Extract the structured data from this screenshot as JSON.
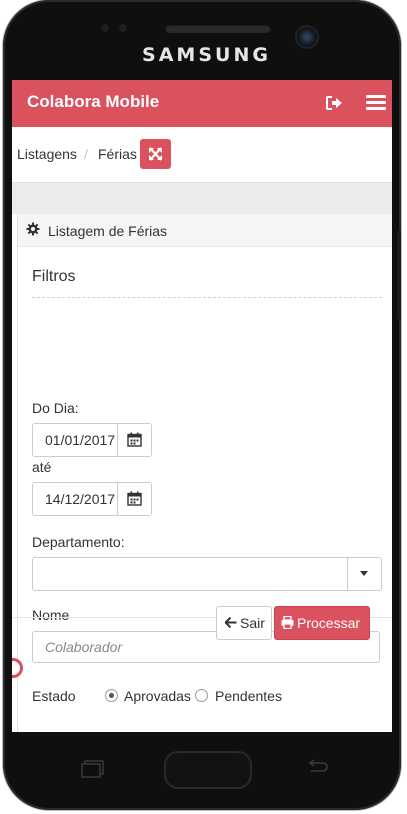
{
  "device": {
    "brand": "SAMSUNG"
  },
  "appbar": {
    "title": "Colabora Mobile",
    "logout_icon": "sign-out-icon",
    "menu_icon": "hamburger-icon"
  },
  "breadcrumb": {
    "items": [
      "Listagens",
      "Férias"
    ],
    "separator": "/",
    "expand_icon": "expand-arrows-icon"
  },
  "panel": {
    "title": "Listagem de Férias",
    "title_icon": "gear-icon",
    "section_title": "Filtros",
    "do_dia_label": "Do Dia:",
    "do_dia_value": "01/01/2017",
    "ate_label": "até",
    "ate_value": "14/12/2017",
    "departamento_label": "Departamento:",
    "departamento_value": "",
    "nome_label": "Nome",
    "nome_placeholder": "Colaborador",
    "nome_value": "",
    "estado_label": "Estado",
    "estado_options": [
      {
        "label": "Aprovadas",
        "checked": true
      },
      {
        "label": "Pendentes",
        "checked": false
      }
    ]
  },
  "actions": {
    "sair_label": "Sair",
    "processar_label": "Processar"
  },
  "colors": {
    "accent": "#d9525e",
    "appbar_text": "#ffffff"
  }
}
